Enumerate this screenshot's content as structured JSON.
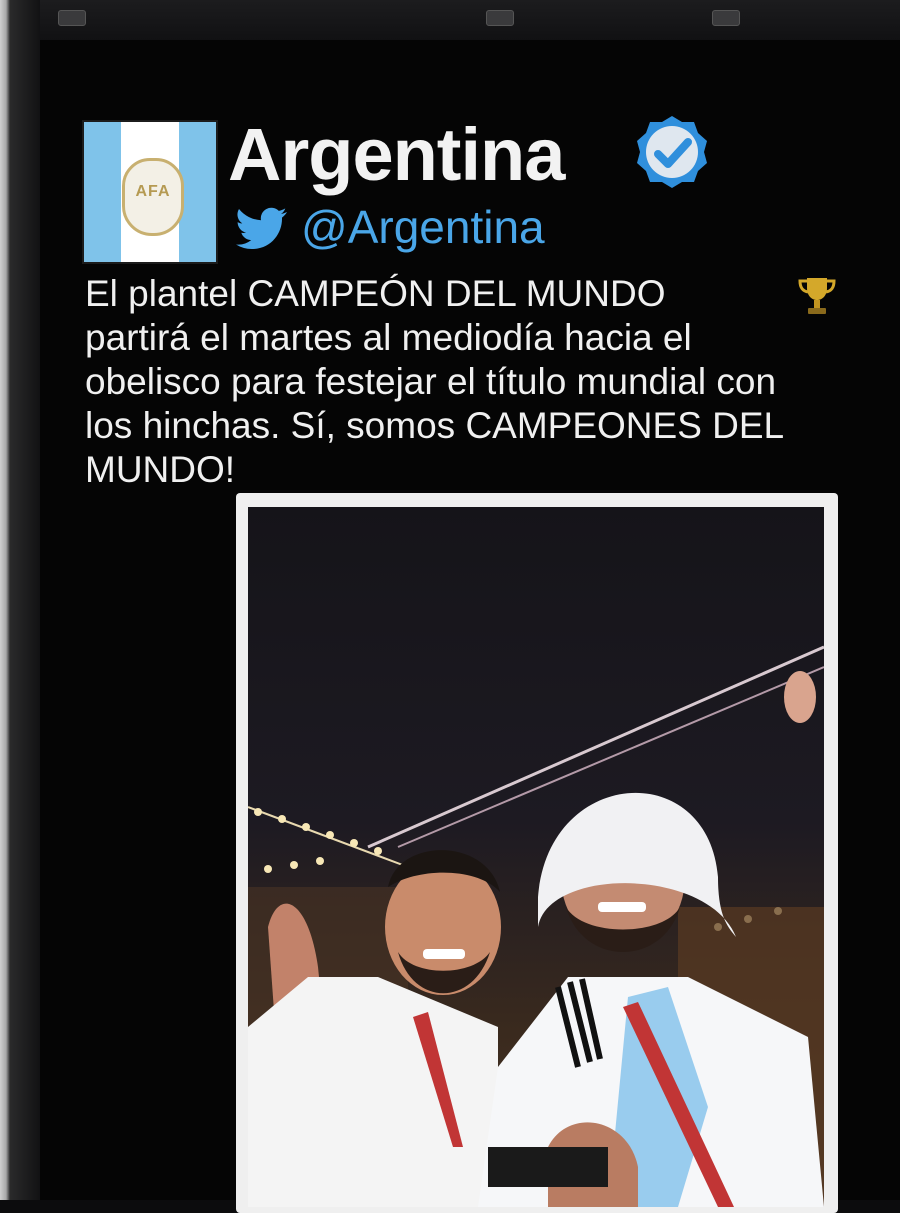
{
  "account": {
    "display_name": "Argentina",
    "handle": "@Argentina",
    "verified": true,
    "avatar_crest_text": "AFA"
  },
  "tweet": {
    "lines": [
      "El plantel CAMPEÓN DEL MUNDO",
      "partirá el martes al mediodía hacia el",
      "obelisco para festejar el título mundial con",
      "los hinchas. Sí, somos CAMPEONES DEL",
      "MUNDO!"
    ],
    "emoji": "trophy-icon"
  },
  "colors": {
    "background": "#050505",
    "text": "#f0f0f0",
    "handle_blue": "#4aa6e8",
    "verified_blue": "#2f8fdc",
    "flag_blue": "#7fc3ea"
  },
  "icons": [
    "verified-badge-icon",
    "twitter-bird-icon",
    "trophy-icon"
  ]
}
